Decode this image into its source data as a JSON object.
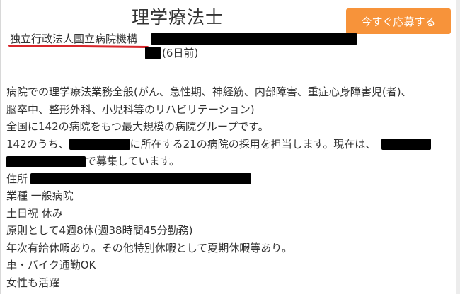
{
  "job": {
    "title": "理学療法士",
    "apply_label": "今すぐ応募する",
    "company": "独立行政法人国立病院機構",
    "posted": "(6日前)"
  },
  "description": {
    "line1": "病院での理学療法業務全般(がん、急性期、神経筋、内部障害、重症心身障害児(者)、",
    "line2": "脳卒中、整形外科、小児科等のリハビリテーション)",
    "line3": "全国に142の病院をもつ最大規模の病院グループです。",
    "line4a": "142のうち、",
    "line4b": "に所在する21の病院の採用を担当します。現在は、",
    "line5": "で募集しています。",
    "line6": "住所",
    "line7": "業種 一般病院",
    "line8": "土日祝 休み",
    "line9": "原則として4週8休(週38時間45分勤務)",
    "line10": "年次有給休暇あり。その他特別休暇として夏期休暇等あり。",
    "line11": "車・バイク通勤OK",
    "line12": "女性も活躍"
  }
}
